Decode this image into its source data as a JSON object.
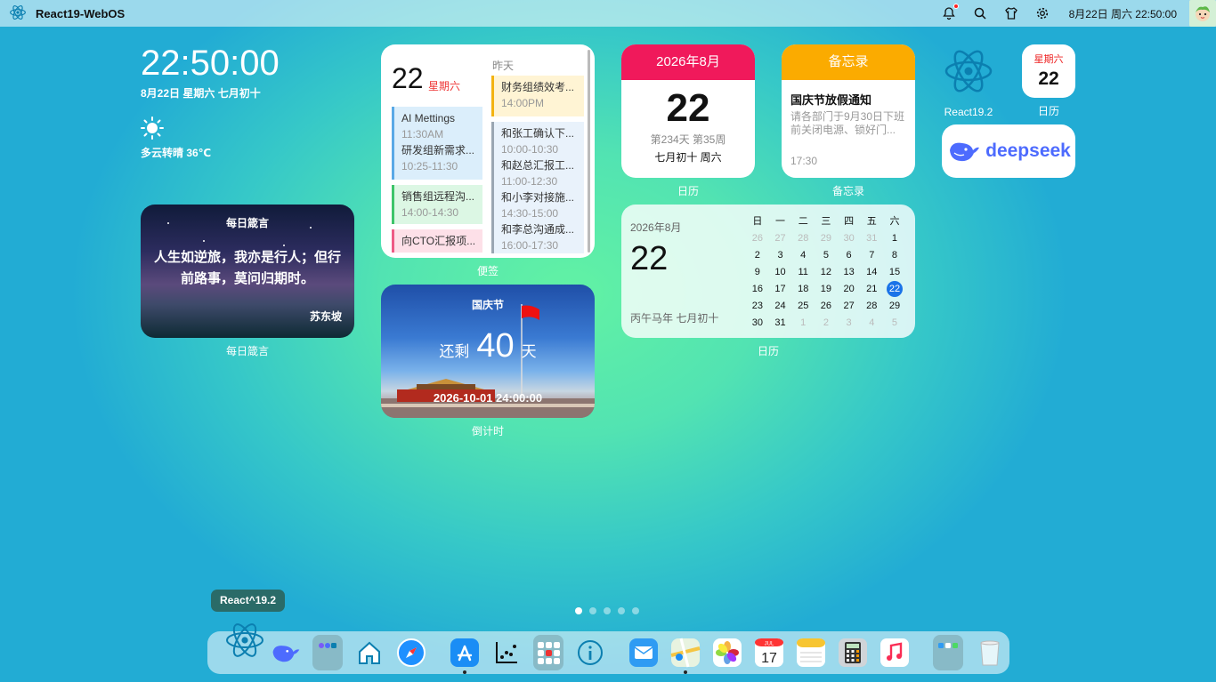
{
  "topbar": {
    "title": "React19-WebOS",
    "datetime": "8月22日 周六 22:50:00",
    "icons": [
      "bell-icon",
      "search-icon",
      "shirt-icon",
      "gear-icon"
    ]
  },
  "clock": {
    "time": "22:50:00",
    "date": "8月22日 星期六 七月初十",
    "weather": "多云转晴 36℃"
  },
  "quote": {
    "title": "每日箴言",
    "text": "人生如逆旅，我亦是行人；但行前路事，莫问归期时。",
    "author": "苏东坡",
    "label": "每日箴言"
  },
  "memo": {
    "day": "22",
    "weekday": "星期六",
    "yesterday_label": "昨天",
    "label": "便签",
    "today_events": [
      {
        "title": "AI Mettings",
        "time": "11:30AM"
      },
      {
        "title": "研发组新需求...",
        "time": "10:25-11:30"
      },
      {
        "title": "销售组远程沟...",
        "time": "14:00-14:30"
      },
      {
        "title": "向CTO汇报项..."
      }
    ],
    "yesterday_events": [
      {
        "title": "财务组绩效考...",
        "time": "14:00PM"
      },
      {
        "title": "和张工确认下...",
        "time": "10:00-10:30"
      },
      {
        "title": "和赵总汇报工...",
        "time": "11:00-12:30"
      },
      {
        "title": "和小李对接施...",
        "time": "14:30-15:00"
      },
      {
        "title": "和李总沟通成...",
        "time": "16:00-17:30"
      }
    ]
  },
  "countdown": {
    "title": "国庆节",
    "prefix": "还剩",
    "days": "40",
    "suffix": "天",
    "target": "2026-10-01 24:00:00",
    "label": "倒计时"
  },
  "calendar_card": {
    "header": "2026年8月",
    "day": "22",
    "stats": "第234天 第35周",
    "lunar": "七月初十 周六",
    "label": "日历"
  },
  "note_card": {
    "header": "备忘录",
    "title": "国庆节放假通知",
    "body": "请各部门于9月30日下班前关闭电源、锁好门...",
    "time": "17:30",
    "label": "备忘录"
  },
  "month_calendar": {
    "year_month": "2026年8月",
    "day": "22",
    "lunar": "丙午马年 七月初十",
    "label": "日历",
    "weekdays": [
      "日",
      "一",
      "二",
      "三",
      "四",
      "五",
      "六"
    ],
    "weeks": [
      [
        "26",
        "27",
        "28",
        "29",
        "30",
        "31",
        "1"
      ],
      [
        "2",
        "3",
        "4",
        "5",
        "6",
        "7",
        "8"
      ],
      [
        "9",
        "10",
        "11",
        "12",
        "13",
        "14",
        "15"
      ],
      [
        "16",
        "17",
        "18",
        "19",
        "20",
        "21",
        "22"
      ],
      [
        "23",
        "24",
        "25",
        "26",
        "27",
        "28",
        "29"
      ],
      [
        "30",
        "31",
        "1",
        "2",
        "3",
        "4",
        "5"
      ]
    ],
    "today": "22"
  },
  "apps": {
    "react": "React19.2",
    "calendar": {
      "weekday": "星期六",
      "day": "22",
      "label": "日历"
    },
    "deepseek": "deepseek"
  },
  "dock": {
    "tooltip": "React^19.2",
    "items": [
      "react-app",
      "deepseek-app",
      "folder-app",
      "home-app",
      "safari-app",
      "appstore-app",
      "stats-app",
      "launchpad-app",
      "info-app",
      "mail-app",
      "maps-app",
      "photos-app",
      "calendar-app",
      "notes-app",
      "calculator-app",
      "music-app",
      "folder2-app",
      "trash-app"
    ],
    "calendar_month": "JUL",
    "calendar_day": "17"
  },
  "colors": {
    "calendar_red": "#f0195b",
    "memo_orange": "#fbab00",
    "today_blue": "#1a73e8"
  }
}
